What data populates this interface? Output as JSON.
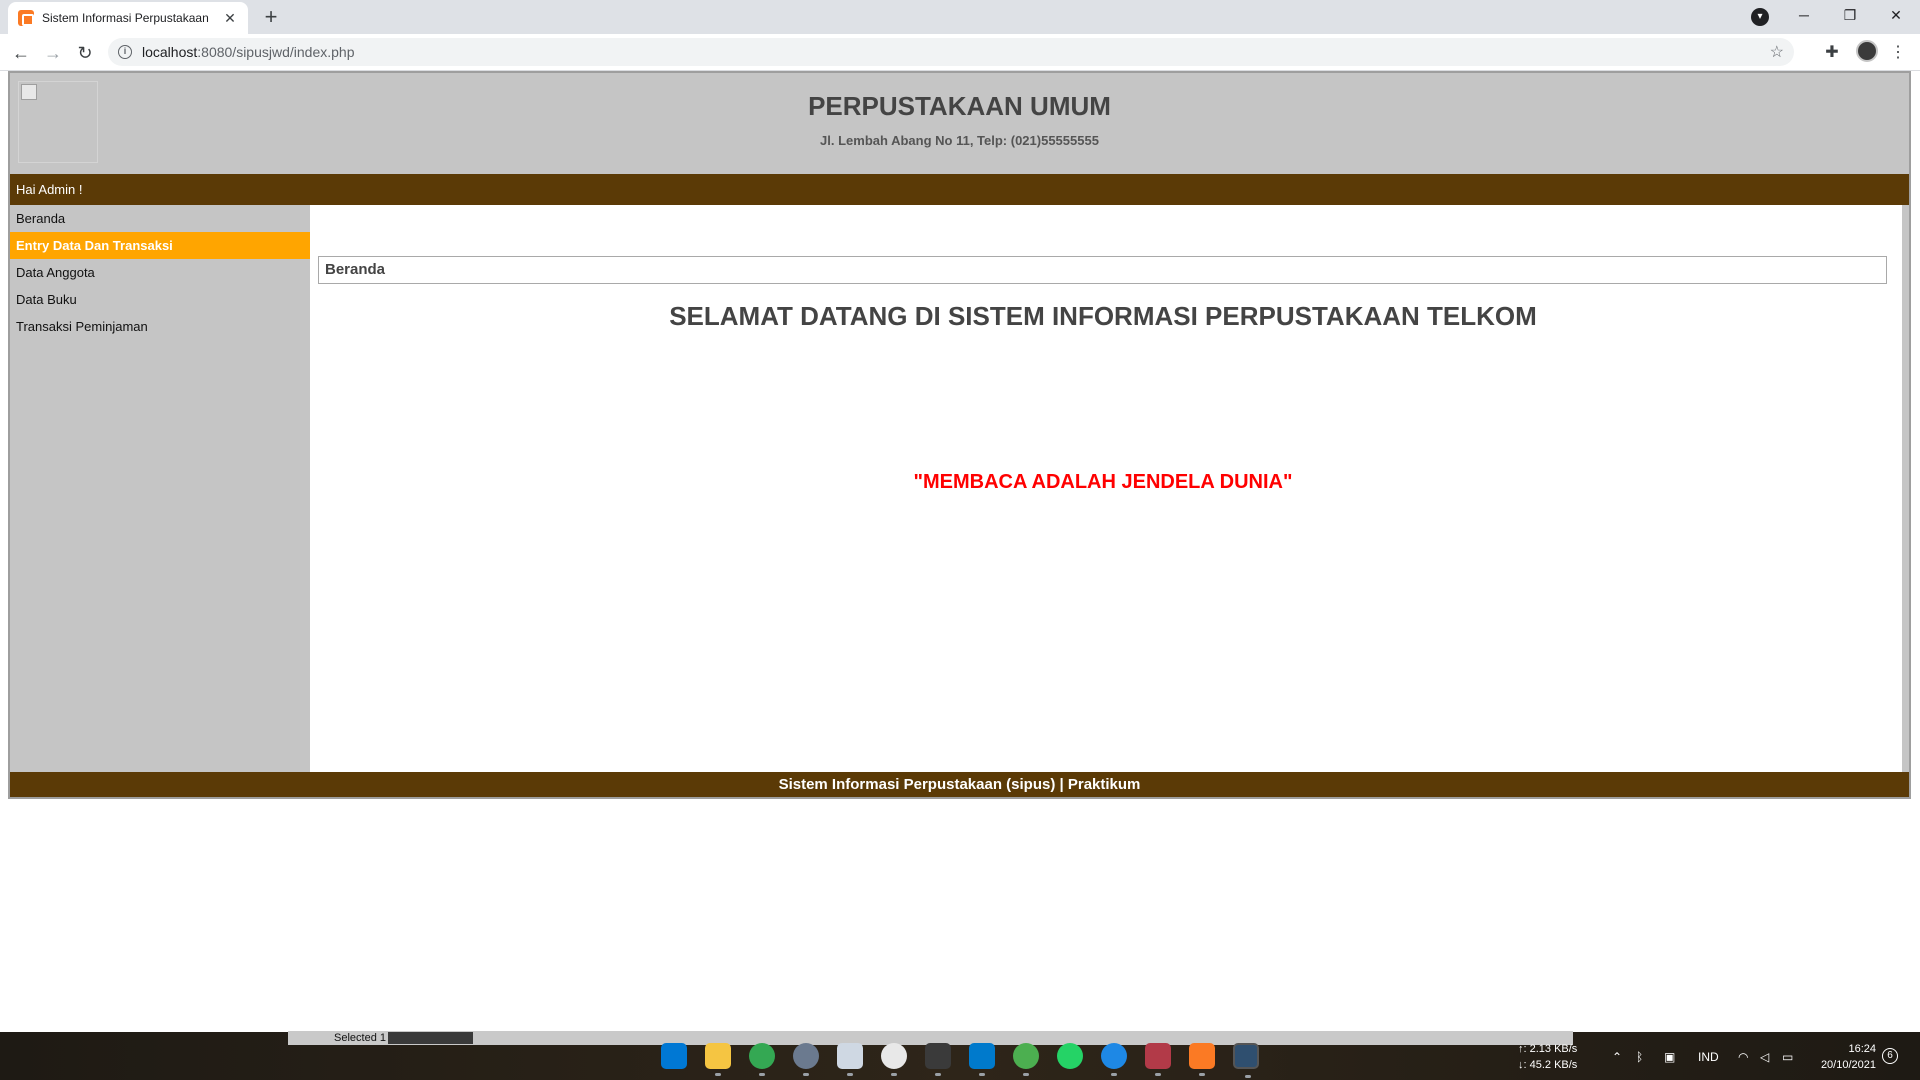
{
  "browser": {
    "tab_title": "Sistem Informasi Perpustakaan",
    "url_host": "localhost",
    "url_path": ":8080/sipusjwd/index.php"
  },
  "header": {
    "title": "PERPUSTAKAAN UMUM",
    "address": "Jl. Lembah Abang No 11, Telp: (021)55555555"
  },
  "greeting": "Hai Admin !",
  "sidebar": {
    "items": [
      {
        "label": "Beranda"
      },
      {
        "label": "Entry Data Dan Transaksi"
      },
      {
        "label": "Data Anggota"
      },
      {
        "label": "Data Buku"
      },
      {
        "label": "Transaksi Peminjaman"
      }
    ]
  },
  "main": {
    "breadcrumb": "Beranda",
    "welcome": "SELAMAT DATANG DI SISTEM INFORMASI PERPUSTAKAAN TELKOM",
    "motto": "\"MEMBACA ADALAH JENDELA DUNIA\""
  },
  "footer": "Sistem Informasi Perpustakaan (sipus) | Praktikum",
  "taskbar": {
    "status_text": "Selected 1",
    "net_up": "↑: 2.13 KB/s",
    "net_down": "↓: 45.2 KB/s",
    "language": "IND",
    "time": "16:24",
    "date": "20/10/2021",
    "notifications": "6"
  },
  "colors": {
    "header_bg": "#c5c5c5",
    "bar_brown": "#5b3a06",
    "menu_active": "#ffa500",
    "motto_red": "#ff0000"
  }
}
